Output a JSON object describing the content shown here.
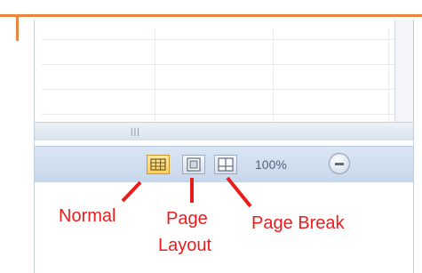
{
  "status_bar": {
    "views": [
      {
        "name": "Normal",
        "icon": "normal-view-icon",
        "active": true
      },
      {
        "name": "Page Layout",
        "icon": "page-layout-view-icon",
        "active": false
      },
      {
        "name": "Page Break",
        "icon": "page-break-preview-icon",
        "active": false
      }
    ],
    "zoom_label": "100%",
    "zoom_out_icon": "zoom-out-icon"
  },
  "annotations": {
    "normal": "Normal",
    "page_layout_line1": "Page",
    "page_layout_line2": "Layout",
    "page_break": "Page Break"
  },
  "colors": {
    "annotation": "#ea1c1c",
    "border_accent": "#e9853f",
    "active_button": "#ffce5c"
  }
}
